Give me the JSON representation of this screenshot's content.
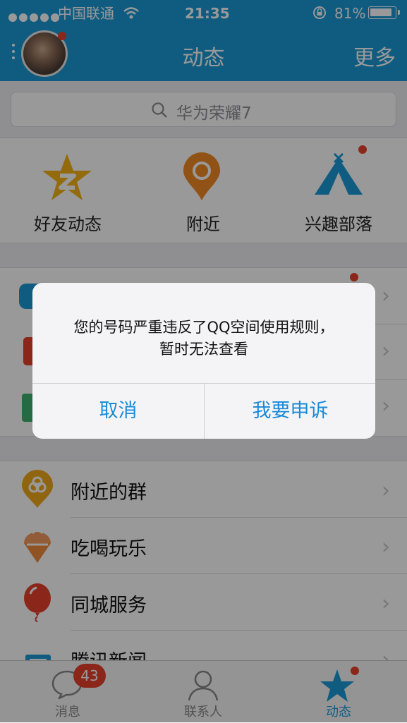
{
  "status_bar": {
    "carrier": "中国联通",
    "time": "21:35",
    "battery": "81%"
  },
  "header": {
    "title": "动态",
    "more": "更多"
  },
  "search": {
    "placeholder": "华为荣耀7"
  },
  "grid": [
    {
      "label": "好友动态",
      "icon": "qzone-star-icon"
    },
    {
      "label": "附近",
      "icon": "location-pin-icon"
    },
    {
      "label": "兴趣部落",
      "icon": "tent-icon"
    }
  ],
  "list": [
    {
      "label": "附近的群",
      "icon": "nearby-group-icon"
    },
    {
      "label": "吃喝玩乐",
      "icon": "ice-cream-icon"
    },
    {
      "label": "同城服务",
      "icon": "balloon-icon"
    },
    {
      "label": "腾讯新闻",
      "icon": "news-icon"
    }
  ],
  "dialog": {
    "message_line1": "您的号码严重违反了QQ空间使用规则，",
    "message_line2": "暂时无法查看",
    "cancel": "取消",
    "appeal": "我要申诉"
  },
  "tabbar": [
    {
      "label": "消息",
      "badge": "43",
      "icon": "chat-bubble-icon"
    },
    {
      "label": "联系人",
      "icon": "contacts-icon"
    },
    {
      "label": "动态",
      "icon": "star-icon"
    }
  ],
  "colors": {
    "brand": "#1b9ad6",
    "dialog_button": "#1a8ad8",
    "badge": "#e6402c"
  }
}
